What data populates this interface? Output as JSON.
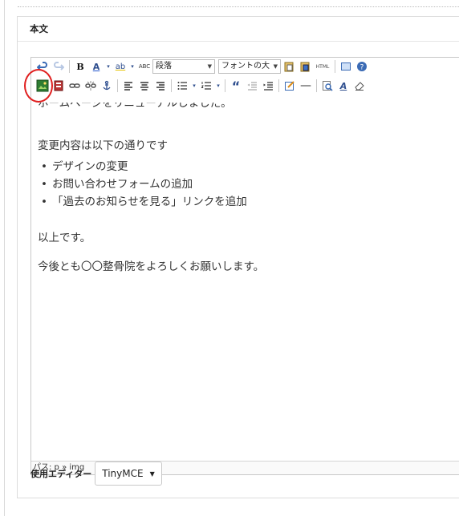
{
  "postbox": {
    "title": "本文"
  },
  "toolbar": {
    "row1": {
      "undo_icon": "undo-icon",
      "redo_icon": "redo-icon",
      "bold_label": "B",
      "underline_label": "A",
      "spellcheck_label": "ab",
      "abc_label": "ABC",
      "format_select": "段落",
      "font_size_select": "フォントの大",
      "html_label": "HTML"
    },
    "row2": {
      "insert_image_icon": "insert-image-icon",
      "quote_label": "“",
      "hr_label": "—",
      "a_label": "A"
    }
  },
  "content": {
    "partial_line": "ホームページをリニューアルしました。",
    "intro": "変更内容は以下の通りです",
    "bullets": [
      "デザインの変更",
      "お問い合わせフォームの追加",
      "「過去のお知らせを見る」リンクを追加"
    ],
    "closing1": "以上です。",
    "closing2": "今後とも〇〇整骨院をよろしくお願いします。"
  },
  "statusbar": {
    "path": "パス: p » img"
  },
  "editor_choice": {
    "label": "使用エディター",
    "value": "TinyMCE"
  },
  "colors": {
    "highlight_circle": "#e02020",
    "toolbar_blue": "#2f4f8f"
  }
}
